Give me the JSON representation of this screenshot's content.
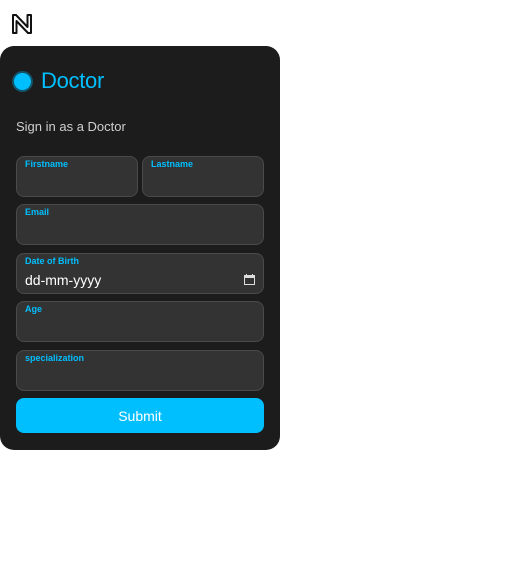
{
  "logo": {
    "icon": "n-logo-icon"
  },
  "card": {
    "title": "Doctor",
    "subtitle": "Sign in as a Doctor",
    "accent_color": "#00bfff",
    "background_color": "#1c1c1c"
  },
  "form": {
    "firstname": {
      "label": "Firstname",
      "value": ""
    },
    "lastname": {
      "label": "Lastname",
      "value": ""
    },
    "email": {
      "label": "Email",
      "value": ""
    },
    "dob": {
      "label": "Date of Birth",
      "value": "dd-mm-yyyy",
      "icon": "calendar-icon"
    },
    "age": {
      "label": "Age",
      "value": ""
    },
    "specialization": {
      "label": "specialization",
      "value": ""
    },
    "submit_label": "Submit"
  }
}
